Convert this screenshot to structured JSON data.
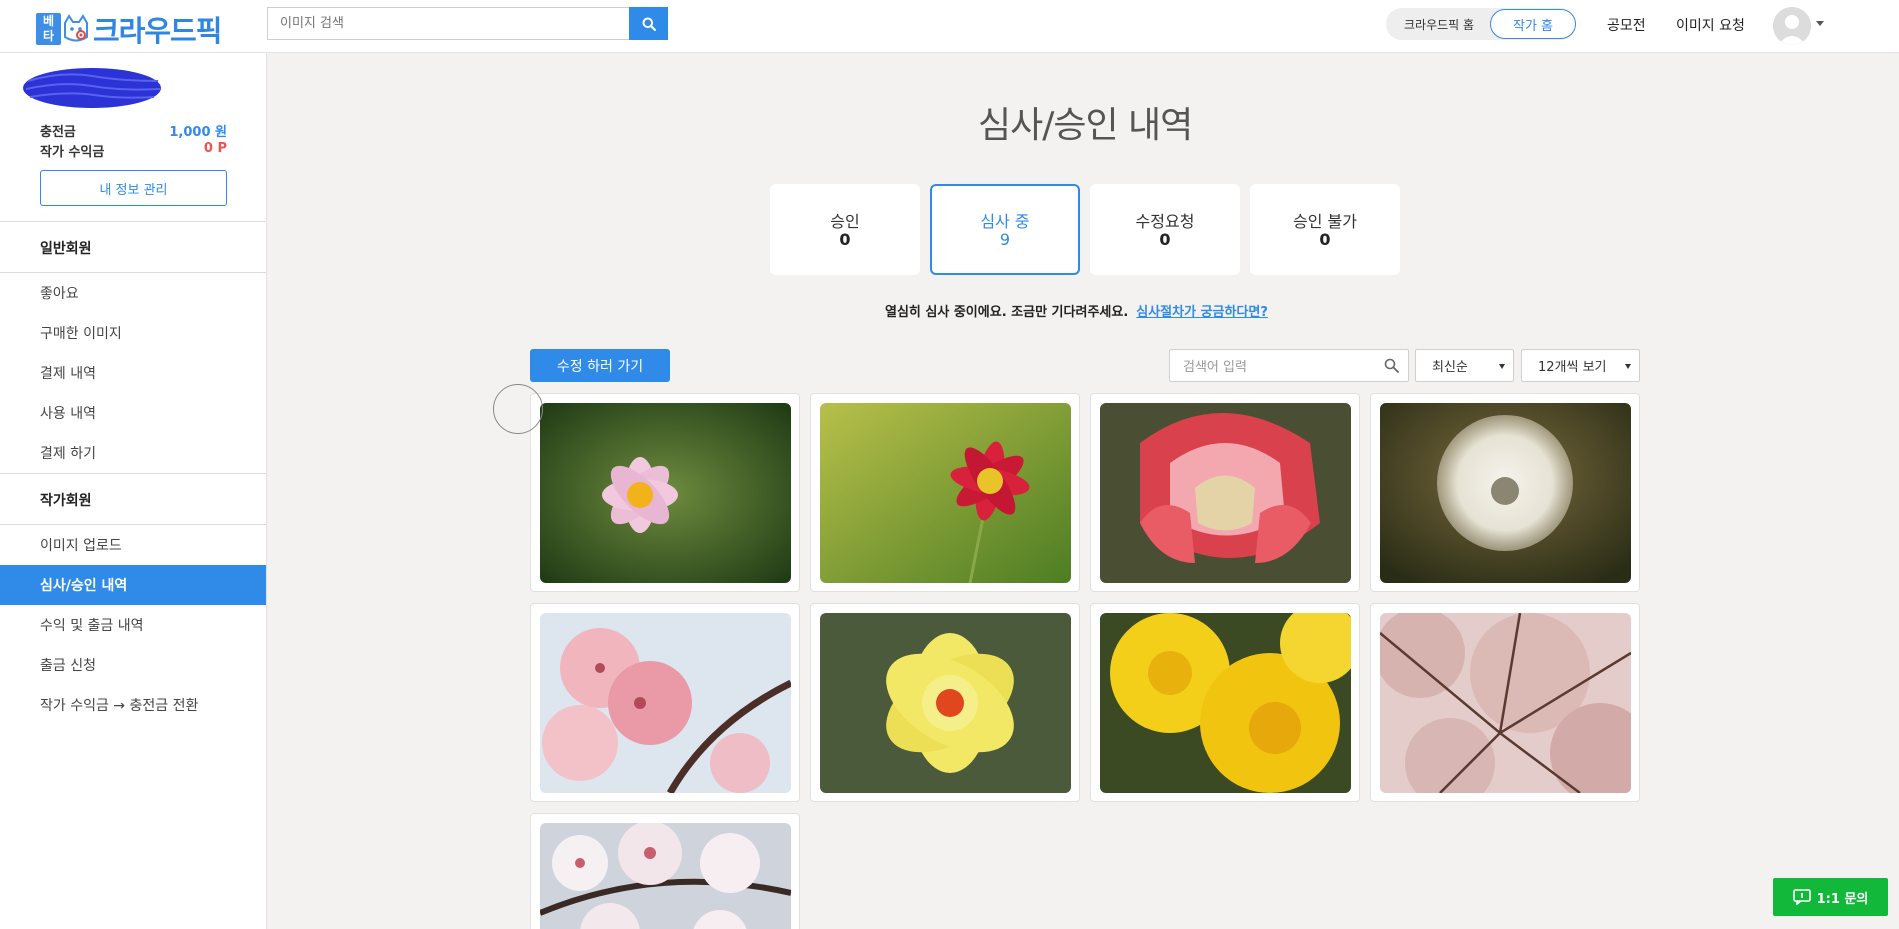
{
  "header": {
    "logo_badge_top": "베",
    "logo_badge_bottom": "타",
    "logo_text": "크라우드픽",
    "search_placeholder": "이미지 검색",
    "toggle_left": "크라우드픽 홈",
    "toggle_right": "작가 홈",
    "nav": [
      "공모전",
      "이미지 요청"
    ]
  },
  "sidebar": {
    "balance_label": "충전금",
    "balance_value": "1,000 원",
    "earnings_label": "작가 수익금",
    "earnings_value": "0 P",
    "profile_button": "내 정보 관리",
    "section_general": "일반회원",
    "general_items": [
      "좋아요",
      "구매한 이미지",
      "결제 내역",
      "사용 내역",
      "결제 하기"
    ],
    "section_author": "작가회원",
    "author_items": [
      "이미지 업로드",
      "심사/승인 내역",
      "수익 및 출금 내역",
      "출금 신청",
      "작가 수익금 → 충전금 전환"
    ],
    "active_item": "심사/승인 내역"
  },
  "main": {
    "title": "심사/승인 내역",
    "tabs": [
      {
        "label": "승인",
        "count": "0"
      },
      {
        "label": "심사 중",
        "count": "9"
      },
      {
        "label": "수정요청",
        "count": "0"
      },
      {
        "label": "승인 불가",
        "count": "0"
      }
    ],
    "active_tab": "심사 중",
    "notice_text": "열심히 심사 중이에요. 조금만 기다려주세요.",
    "notice_link": "심사절차가 궁금하다면?",
    "edit_button": "수정 하러 가기",
    "filter_placeholder": "검색어 입력",
    "sort_select": "최신순",
    "per_page_select": "12개씩 보기",
    "images": [
      {
        "subject": "pink-cosmos"
      },
      {
        "subject": "red-cosmos"
      },
      {
        "subject": "red-tulip"
      },
      {
        "subject": "dandelion"
      },
      {
        "subject": "peach-blossom"
      },
      {
        "subject": "yellow-daffodil"
      },
      {
        "subject": "yellow-daffodils"
      },
      {
        "subject": "cherry-tree"
      },
      {
        "subject": "cherry-blossom"
      }
    ]
  },
  "inquiry_button": "1:1 문의",
  "colors": {
    "accent": "#2f8ae8",
    "earnings_red": "#ef5050",
    "inquiry_green": "#12b83a"
  }
}
